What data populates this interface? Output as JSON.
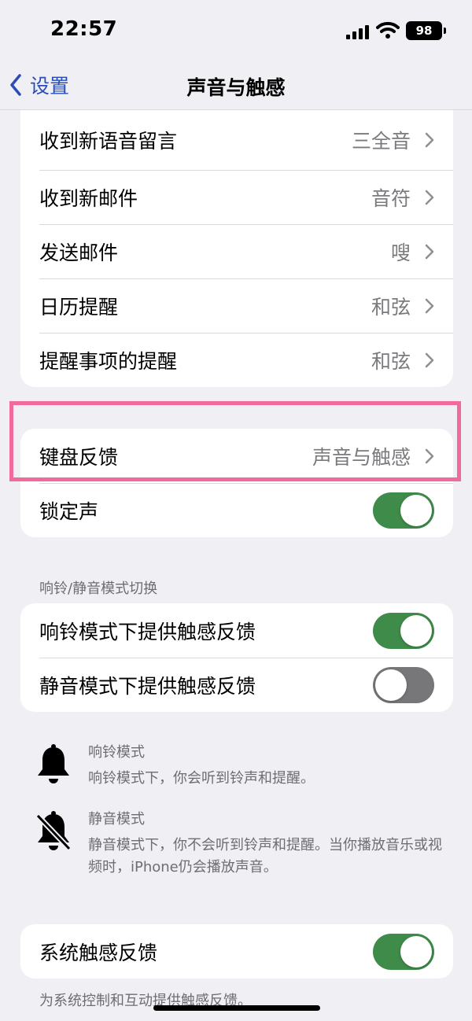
{
  "status_bar": {
    "time": "22:57",
    "battery": "98"
  },
  "nav": {
    "back_label": "设置",
    "title": "声音与触感"
  },
  "alerts_group": {
    "rows": [
      {
        "label": "收到新语音留言",
        "value": "三全音"
      },
      {
        "label": "收到新邮件",
        "value": "音符"
      },
      {
        "label": "发送邮件",
        "value": "嗖"
      },
      {
        "label": "日历提醒",
        "value": "和弦"
      },
      {
        "label": "提醒事项的提醒",
        "value": "和弦"
      }
    ]
  },
  "keyboard_group": {
    "feedback": {
      "label": "键盘反馈",
      "value": "声音与触感"
    },
    "lock_sound": {
      "label": "锁定声",
      "on": true
    }
  },
  "ring_silent": {
    "header": "响铃/静音模式切换",
    "rows": [
      {
        "label": "响铃模式下提供触感反馈",
        "on": true
      },
      {
        "label": "静音模式下提供触感反馈",
        "on": false
      }
    ]
  },
  "modes": [
    {
      "title": "响铃模式",
      "desc": "响铃模式下，你会听到铃声和提醒。",
      "icon": "bell-icon"
    },
    {
      "title": "静音模式",
      "desc": "静音模式下，你不会听到铃声和提醒。当你播放音乐或视频时，iPhone仍会播放声音。",
      "icon": "bell-slash-icon"
    }
  ],
  "system_haptics": {
    "label": "系统触感反馈",
    "on": true,
    "note": "为系统控制和互动提供触感反馈。"
  },
  "colors": {
    "accent": "#2a4db7",
    "toggle_on": "#3f8b4a",
    "toggle_off": "#777779",
    "highlight": "#f06b9c"
  }
}
